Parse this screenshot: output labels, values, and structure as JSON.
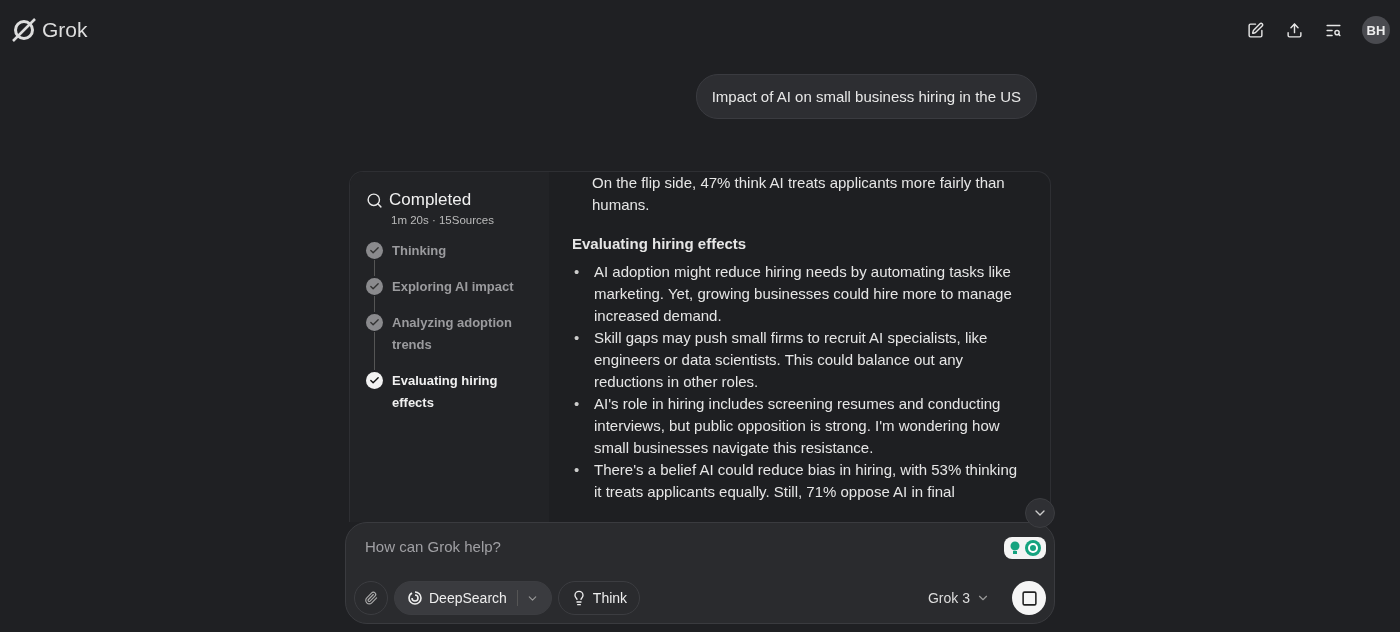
{
  "header": {
    "logo": "Grok",
    "avatar": "BH"
  },
  "user_message": "Impact of AI on small business hiring in the US",
  "search_panel": {
    "title": "Completed",
    "meta": "1m 20s · 15Sources",
    "steps": [
      {
        "label": "Thinking",
        "current": false
      },
      {
        "label": "Exploring AI impact",
        "current": false
      },
      {
        "label": "Analyzing adoption trends",
        "current": false
      },
      {
        "label": "Evaluating hiring effects",
        "current": true
      }
    ]
  },
  "answer": {
    "lead": "On the flip side, 47% think AI treats applicants more fairly than humans.",
    "heading": "Evaluating hiring effects",
    "bullets": [
      {
        "marker": "•",
        "text": "AI adoption might reduce hiring needs by automating tasks like marketing. Yet, growing businesses could hire more to manage increased demand."
      },
      {
        "marker": "•",
        "text": "Skill gaps may push small firms to recruit AI specialists, like engineers or data scientists. This could balance out any reductions in other roles."
      },
      {
        "marker": "•",
        "text": "AI's role in hiring includes screening resumes and conducting interviews, but public opposition is strong. I'm wondering how small businesses navigate this resistance."
      },
      {
        "marker": "•",
        "text": "There's a belief AI could reduce bias in hiring, with 53% thinking it treats applicants equally. Still, 71% oppose AI in final"
      }
    ]
  },
  "composer": {
    "placeholder": "How can Grok help?",
    "deepsearch": {
      "label": "DeepSearch",
      "selected": true
    },
    "think": {
      "label": "Think",
      "selected": false
    },
    "model": "Grok 3"
  }
}
